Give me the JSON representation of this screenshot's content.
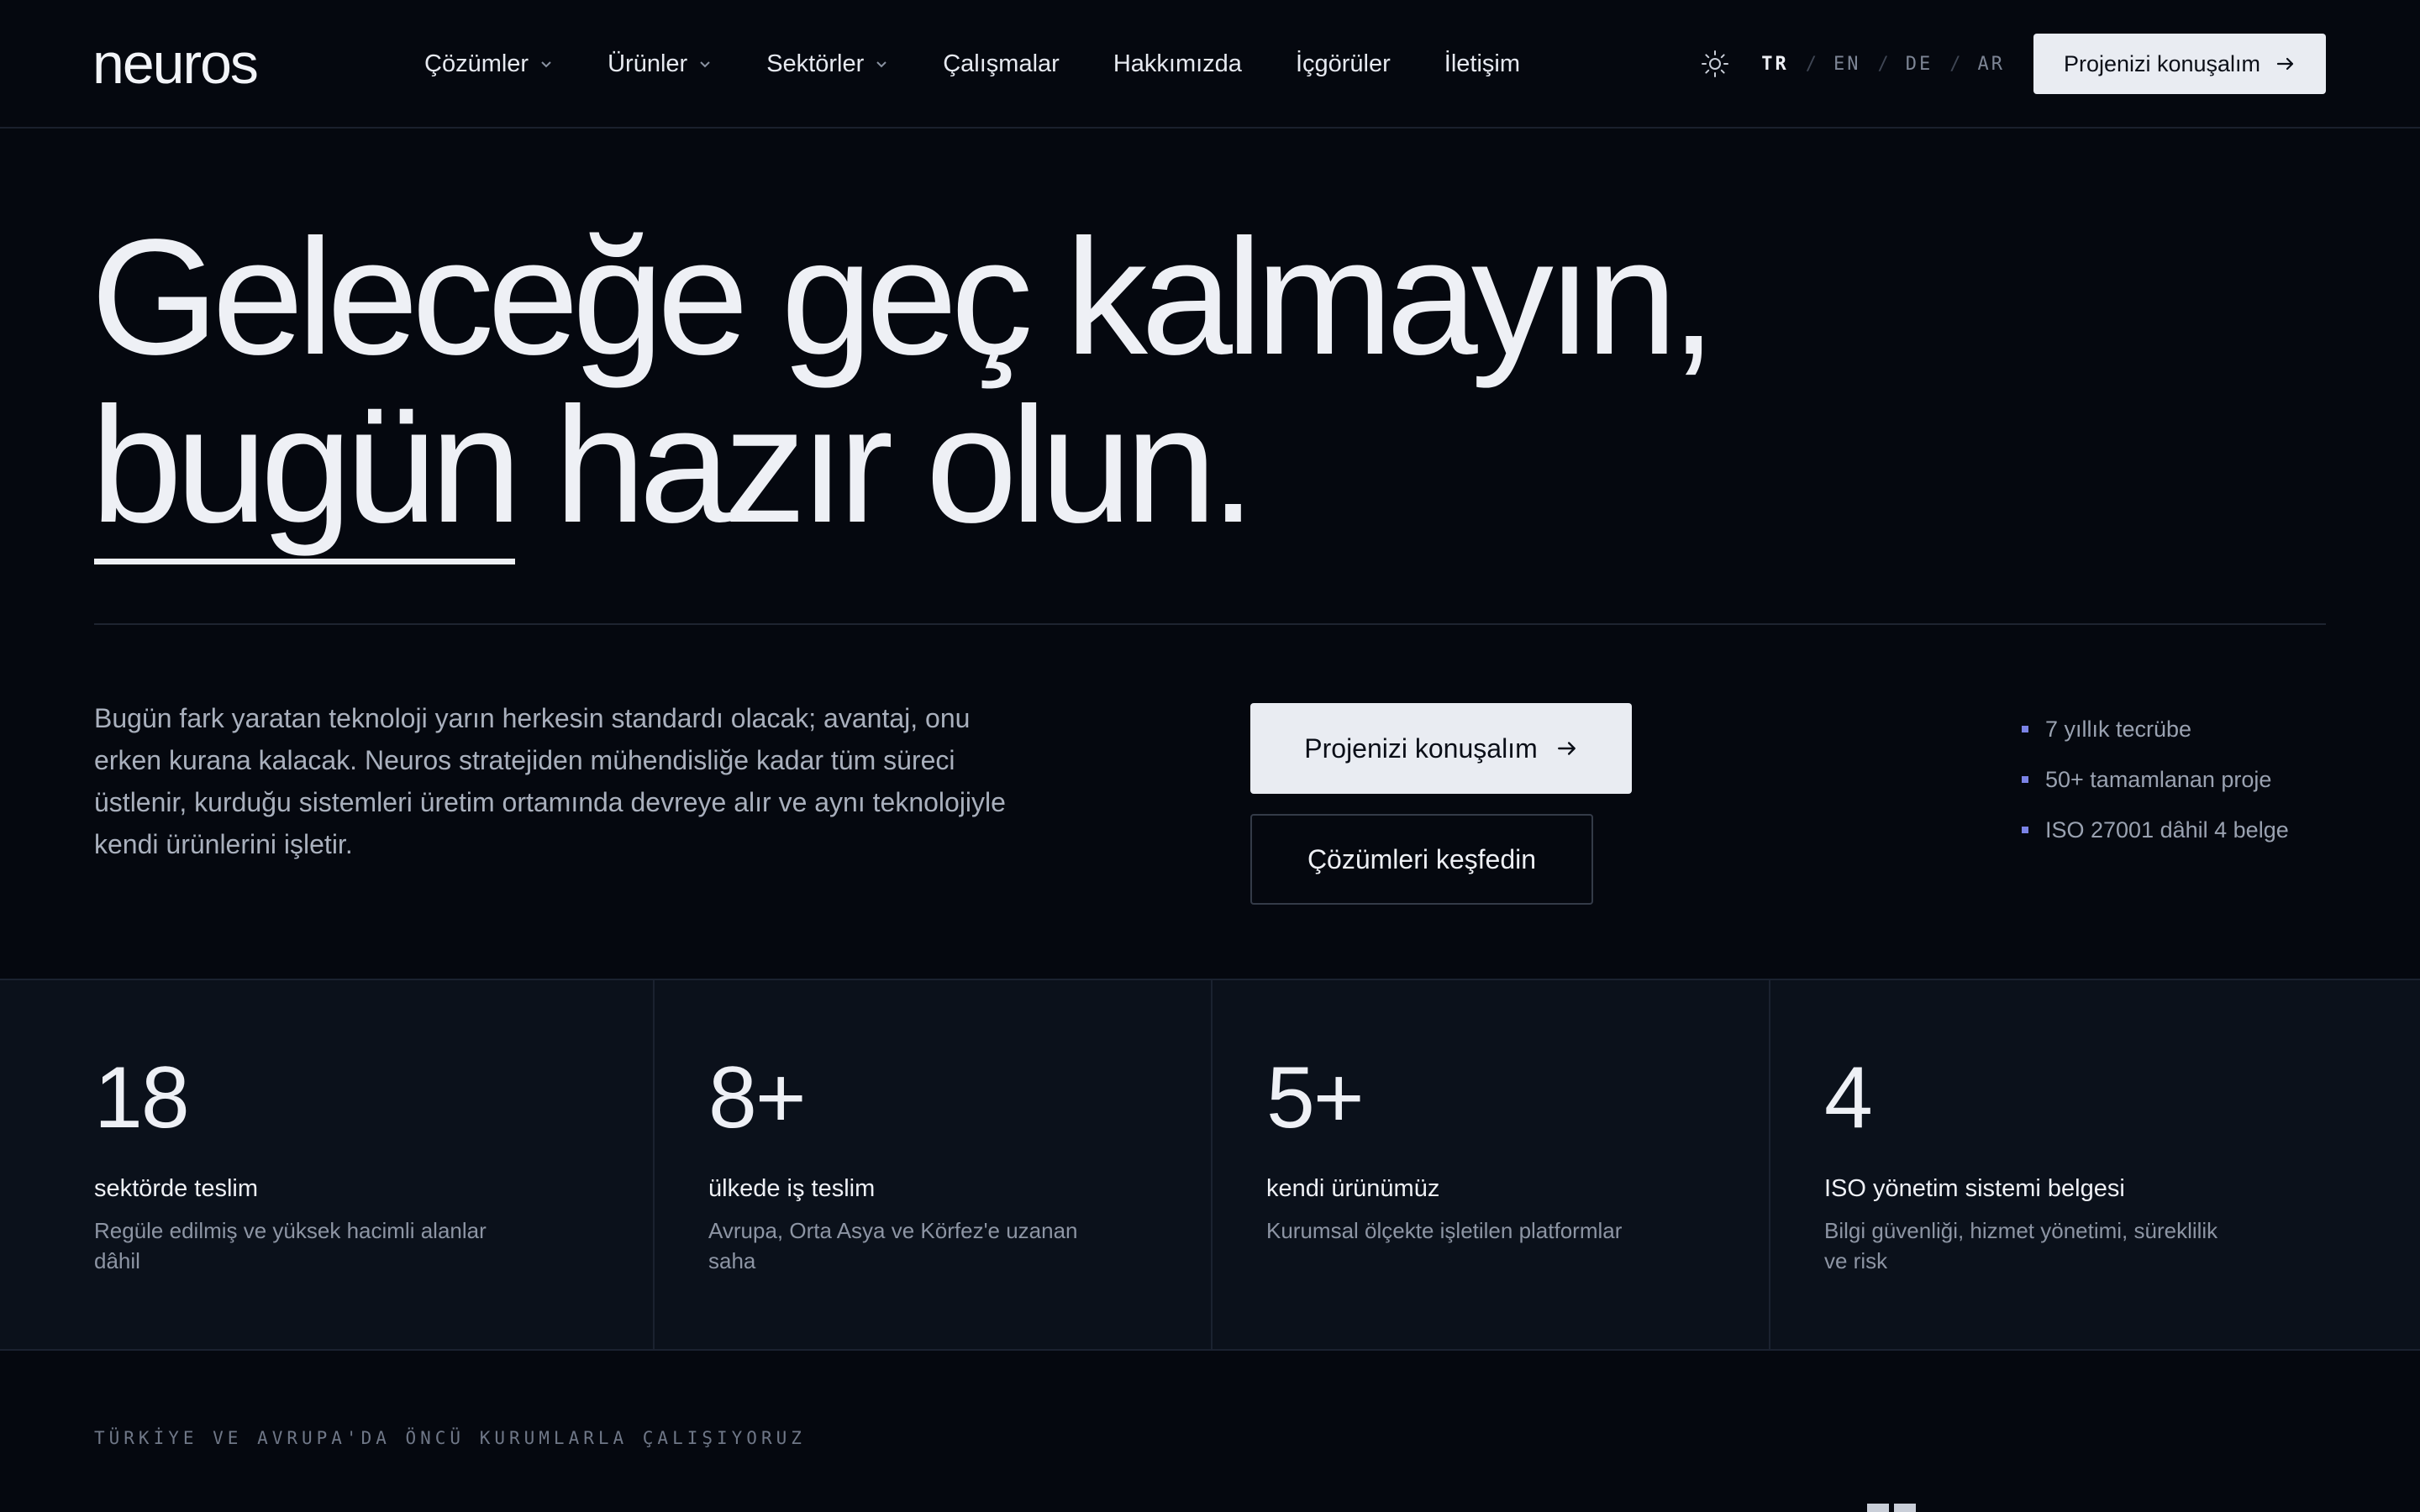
{
  "nav": {
    "logo": "neuros",
    "menu": [
      {
        "label": "Çözümler",
        "dropdown": true
      },
      {
        "label": "Ürünler",
        "dropdown": true
      },
      {
        "label": "Sektörler",
        "dropdown": true
      },
      {
        "label": "Çalışmalar",
        "dropdown": false
      },
      {
        "label": "Hakkımızda",
        "dropdown": false
      },
      {
        "label": "İçgörüler",
        "dropdown": false
      },
      {
        "label": "İletişim",
        "dropdown": false
      }
    ],
    "theme_icon": "sun-icon",
    "languages": [
      "TR",
      "EN",
      "DE",
      "AR"
    ],
    "active_language": "TR",
    "language_separator": "/",
    "cta_label": "Projenizi konuşalım"
  },
  "hero": {
    "line1": "Geleceğe geç kalmayın,",
    "line2_underlined": "bugün",
    "line2_rest": " hazır olun.",
    "description": "Bugün fark yaratan teknoloji yarın herkesin standardı olacak; avantaj, onu erken kurana kalacak. Neuros stratejiden mühendisliğe kadar tüm süreci üstlenir, kurduğu sistemleri üretim ortamında devreye alır ve aynı teknolojiyle kendi ürünlerini işletir.",
    "primary_button": "Projenizi konuşalım",
    "secondary_button": "Çözümleri keşfedin",
    "facts": [
      "7 yıllık tecrübe",
      "50+ tamamlanan proje",
      "ISO 27001 dâhil 4 belge"
    ]
  },
  "stats": [
    {
      "value": "18",
      "label": "sektörde teslim",
      "desc": "Regüle edilmiş ve yüksek hacimli alanlar dâhil"
    },
    {
      "value": "8+",
      "label": "ülkede iş teslim",
      "desc": "Avrupa, Orta Asya ve Körfez'e uzanan saha"
    },
    {
      "value": "5+",
      "label": "kendi ürünümüz",
      "desc": "Kurumsal ölçekte işletilen platformlar"
    },
    {
      "value": "4",
      "label": "ISO yönetim sistemi belgesi",
      "desc": "Bilgi güvenliği, hizmet yönetimi, süreklilik ve risk"
    }
  ],
  "partners": {
    "caption": "TÜRKİYE VE AVRUPA'DA ÖNCÜ KURUMLARLA ÇALIŞIYORUZ"
  },
  "colors": {
    "background": "#05080f",
    "stats_background": "#0b111b",
    "button_light": "#e9ecf2",
    "text_primary": "#eef0f5",
    "text_muted": "#a9b0bd",
    "accent_bullet": "#7b83e6"
  }
}
